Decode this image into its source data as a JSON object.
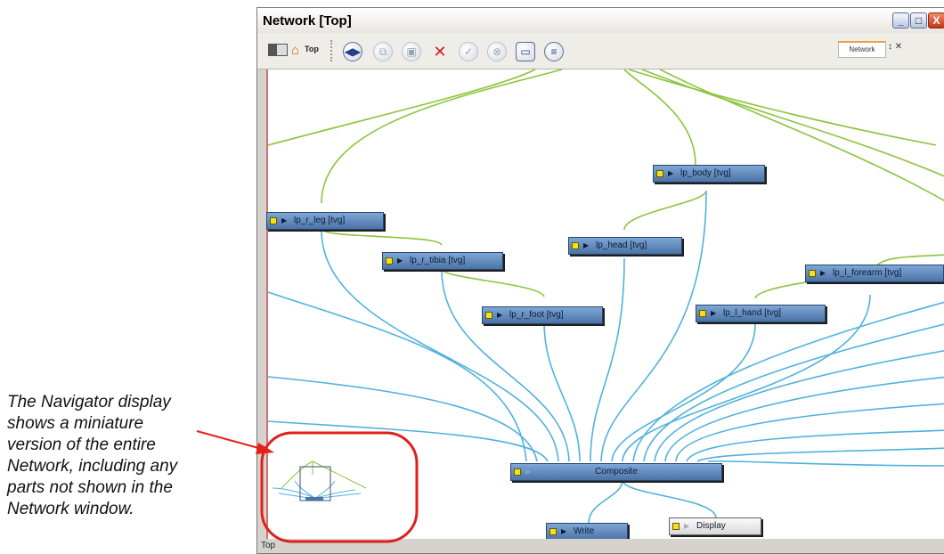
{
  "callout": {
    "lines": [
      "The Navigator display",
      "shows a miniature",
      "version of the entire",
      "Network, including any",
      "parts not shown in the",
      "Network window."
    ]
  },
  "window": {
    "title": "Network [Top]",
    "minimize": "_",
    "maximize": "□",
    "close": "X"
  },
  "toolbar": {
    "top_label": "Top",
    "view_tab": "Network"
  },
  "nodes": {
    "lp_r_leg": "lp_r_leg [tvg]",
    "lp_r_tibia": "lp_r_tibia [tvg]",
    "lp_r_foot": "lp_r_foot [tvg]",
    "lp_body": "lp_body [tvg]",
    "lp_head": "lp_head [tvg]",
    "lp_l_forearm": "lp_l_forearm [tvg]",
    "lp_l_hand": "lp_l_hand [tvg]",
    "composite": "Composite",
    "write": "Write",
    "display": "Display"
  },
  "status": {
    "path": "Top"
  },
  "colors": {
    "cable_green": "#8cc43c",
    "cable_blue": "#4fb2dc",
    "node_blue": "#5b84b8",
    "highlight_red": "#e0201a",
    "arrow_red": "#e8201a"
  }
}
